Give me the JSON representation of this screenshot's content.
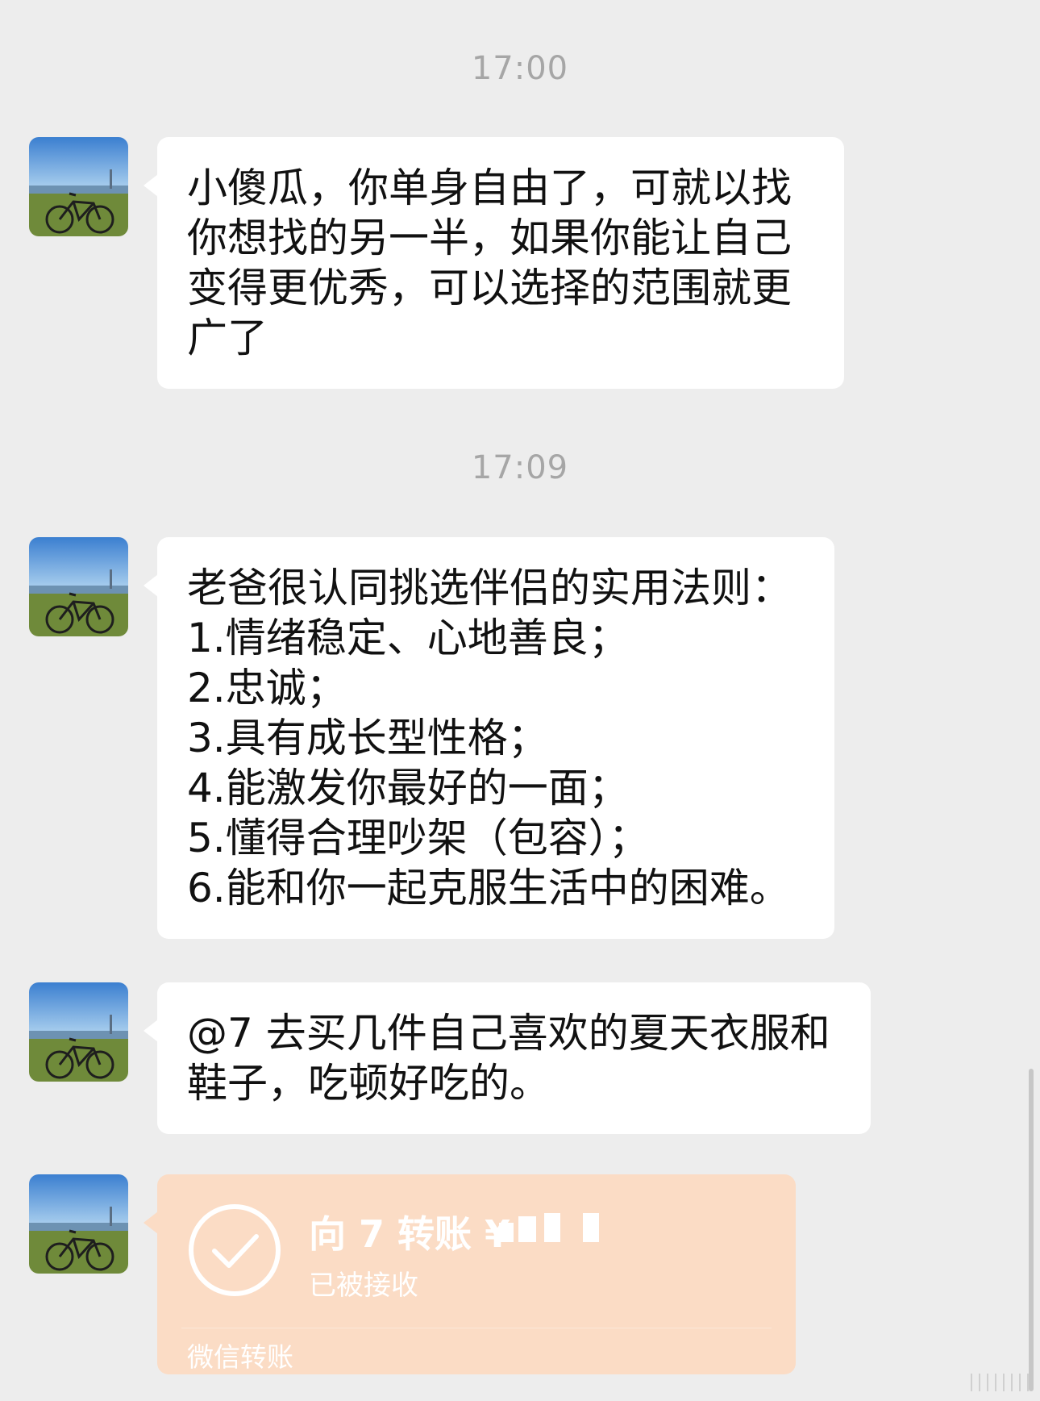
{
  "messages": [
    {
      "time": "17:00",
      "lines": [
        "小傻瓜，你单身自由了，可就以找",
        "你想找的另一半，如果你能让自己",
        "变得更优秀，可以选择的范围就更",
        "广了"
      ]
    },
    {
      "time": "17:09",
      "lines": [
        "老爸很认同挑选伴侣的实用法则：",
        "1.情绪稳定、心地善良；",
        "2.忠诚；",
        "3.具有成长型性格；",
        "4.能激发你最好的一面；",
        "5.懂得合理吵架（包容）；",
        "6.能和你一起克服生活中的困难。"
      ]
    },
    {
      "lines": [
        "@7 去买几件自己喜欢的夏天衣服和",
        "鞋子，吃顿好吃的。"
      ]
    }
  ],
  "transfer": {
    "title": "向 7 转账 ¥",
    "status": "已被接收",
    "footer": "微信转账"
  },
  "colors": {
    "background": "#ededed",
    "bubble": "#ffffff",
    "transfer_card": "#fbdcc5",
    "timestamp": "#a6a6a6"
  },
  "icons": {
    "avatar": "avatar-bike-landscape",
    "transfer_status": "check-circle-icon"
  }
}
